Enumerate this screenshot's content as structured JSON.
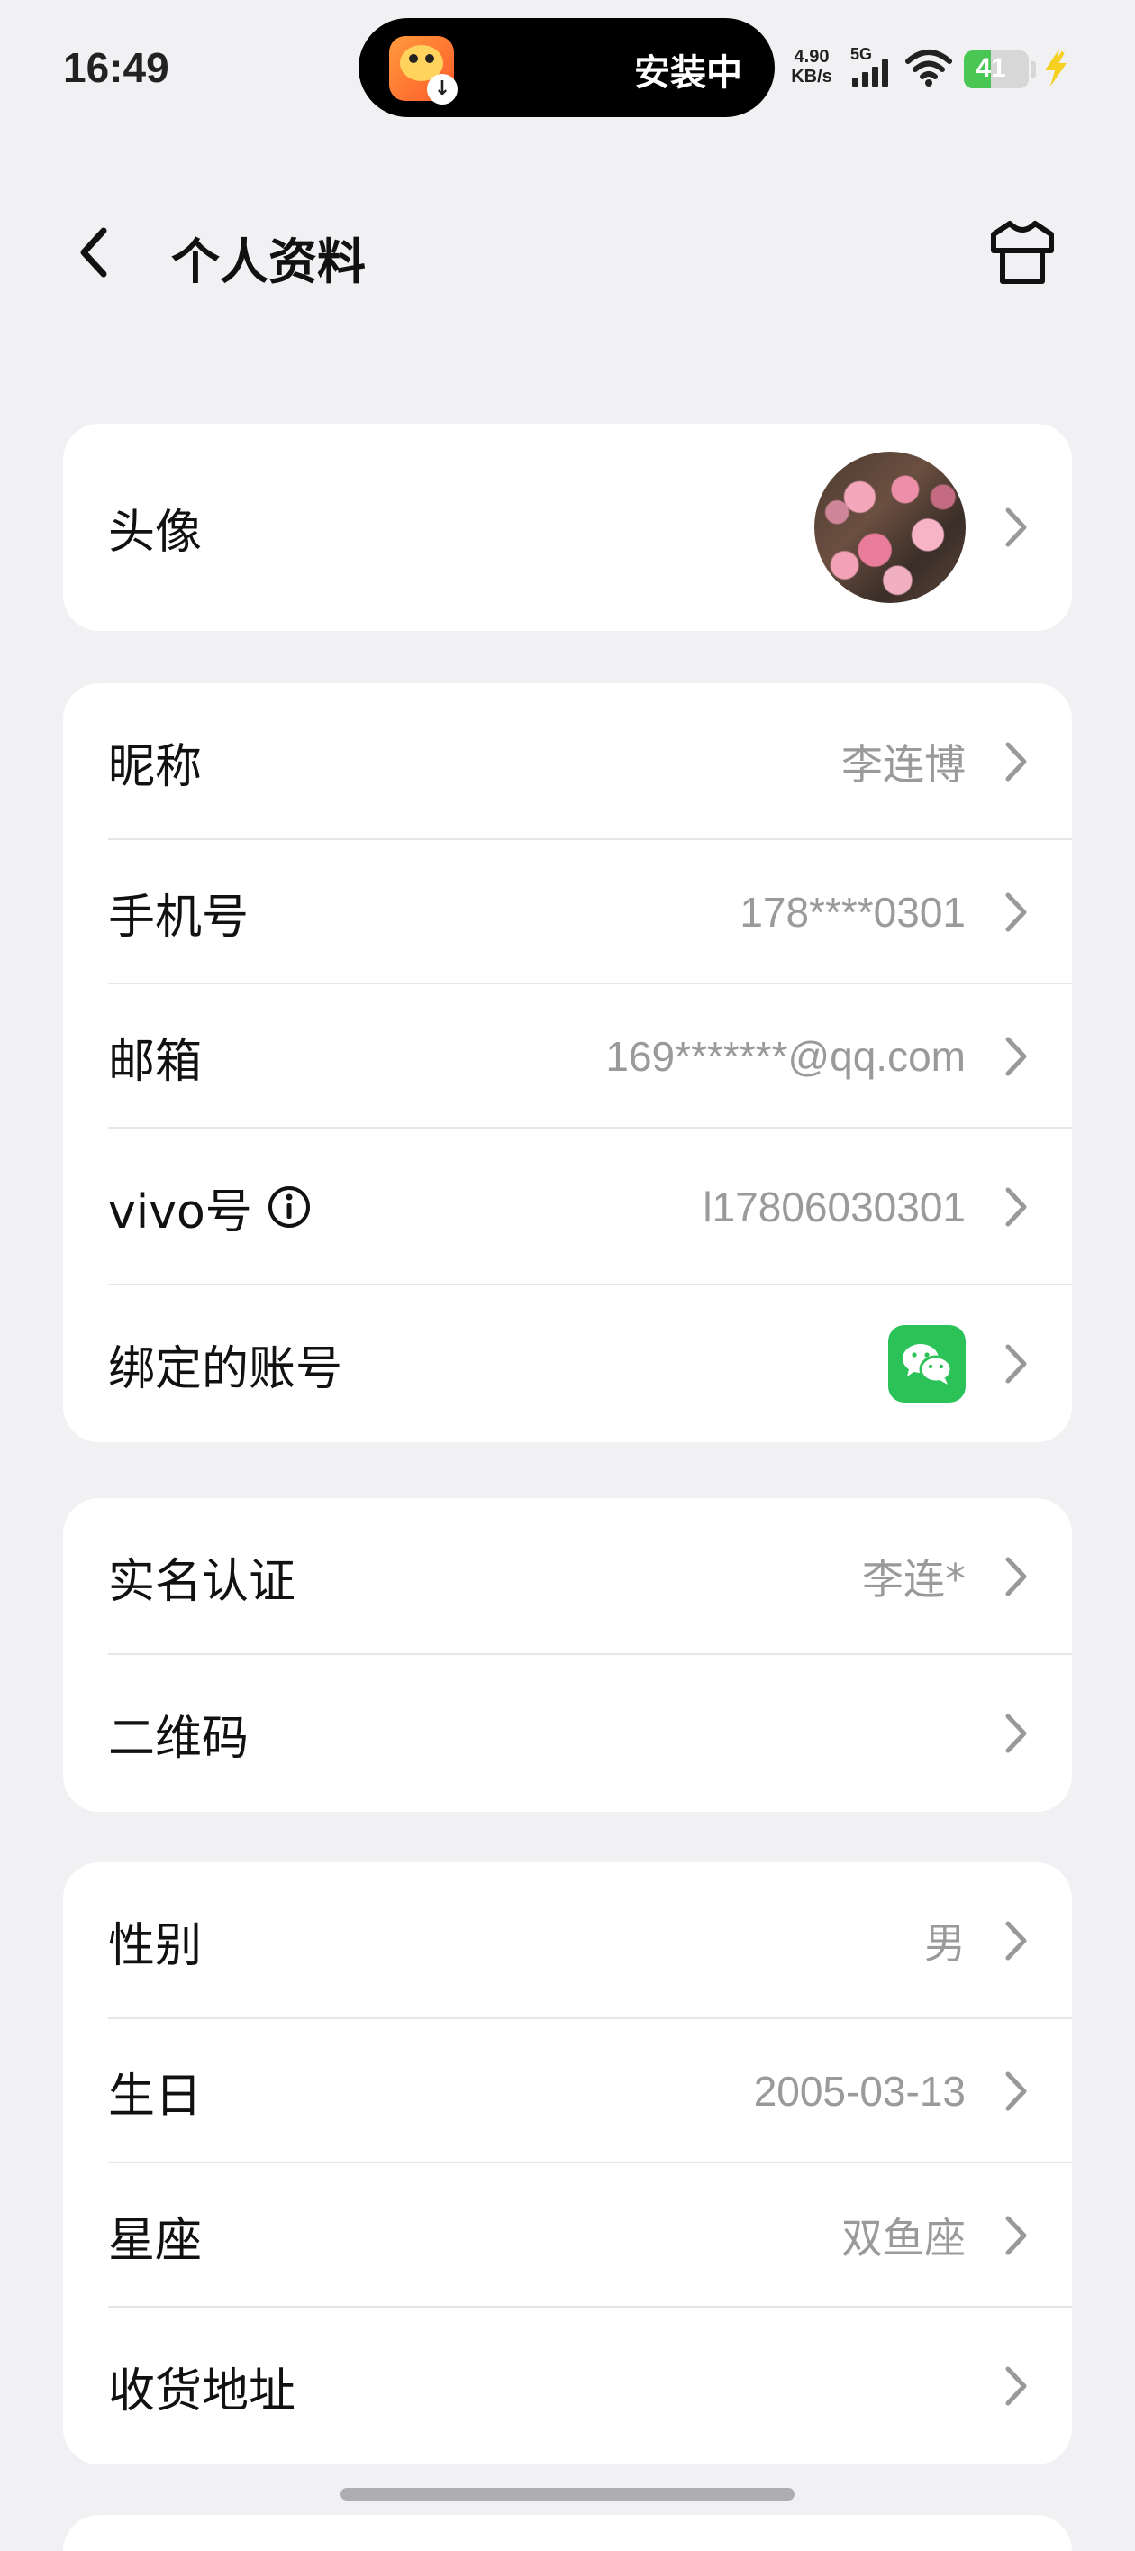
{
  "status_bar": {
    "time": "16:49",
    "island_text": "安装中",
    "net_speed_value": "4.90",
    "net_speed_unit": "KB/s",
    "network": "5G",
    "battery": "41",
    "battery_level": 0.41
  },
  "header": {
    "title": "个人资料"
  },
  "avatar_section": {
    "label": "头像"
  },
  "account_section": {
    "items": [
      {
        "label": "昵称",
        "value": "李连博"
      },
      {
        "label": "手机号",
        "value": "178****0301"
      },
      {
        "label": "邮箱",
        "value": "169*******@qq.com"
      },
      {
        "label": "vivo号",
        "value": "l17806030301"
      },
      {
        "label": "绑定的账号",
        "value_icon": "wechat-icon"
      }
    ]
  },
  "identity_section": {
    "items": [
      {
        "label": "实名认证",
        "value": "李连*"
      },
      {
        "label": "二维码",
        "value": ""
      }
    ]
  },
  "personal_section": {
    "items": [
      {
        "label": "性别",
        "value": "男"
      },
      {
        "label": "生日",
        "value": "2005-03-13"
      },
      {
        "label": "星座",
        "value": "双鱼座"
      },
      {
        "label": "收货地址",
        "value": ""
      }
    ]
  },
  "colors": {
    "background": "#f1f1f4",
    "card": "#ffffff",
    "value_text": "#9a9a9a",
    "wechat_green": "#2bc258",
    "battery_green": "#49c653"
  }
}
